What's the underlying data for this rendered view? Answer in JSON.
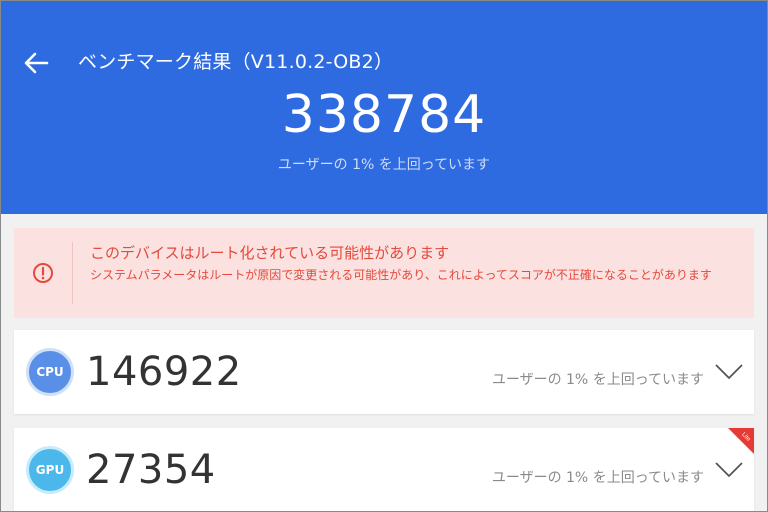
{
  "header": {
    "title": "ベンチマーク結果（V11.0.2-OB2）",
    "total_score": "338784",
    "total_rank": "ユーザーの 1% を上回っています",
    "back_icon": "back-arrow-icon"
  },
  "warning": {
    "title": "このデバイスはルート化されている可能性があります",
    "body": "システムパラメータはルートが原因で変更される可能性があり、これによってスコアが不正確になることがあります",
    "icon": "alert-circle-icon",
    "color": "#e5493c"
  },
  "scores": {
    "cpu": {
      "badge": "CPU",
      "value": "146922",
      "rank": "ユーザーの 1% を上回っています"
    },
    "gpu": {
      "badge": "GPU",
      "value": "27354",
      "rank": "ユーザーの 1% を上回っています",
      "corner_tag": "Lite"
    }
  },
  "colors": {
    "header_bg": "#2f6be0",
    "warning_bg": "#fbe1df",
    "cpu_badge": "#5a8fe8",
    "gpu_badge": "#4cb7ea",
    "lite_tag": "#e83a34"
  }
}
